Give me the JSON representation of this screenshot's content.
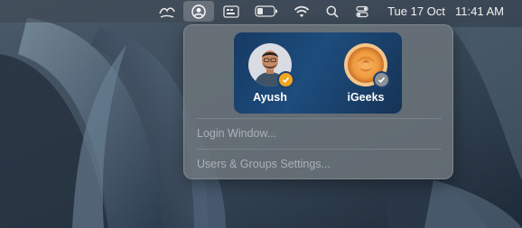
{
  "menubar": {
    "date": "Tue 17 Oct",
    "time": "11:41 AM",
    "icons": [
      "weather-icon",
      "user-account-icon",
      "input-source-icon",
      "battery-icon",
      "wifi-icon",
      "search-icon",
      "control-center-icon"
    ]
  },
  "user_menu": {
    "users": [
      {
        "name": "Ayush",
        "badge_color": "#f2a51e",
        "avatar": "person-photo"
      },
      {
        "name": "iGeeks",
        "badge_color": "#8d9096",
        "avatar": "rose-photo"
      }
    ],
    "items": [
      {
        "label": "Login Window..."
      },
      {
        "label": "Users & Groups Settings..."
      }
    ]
  }
}
